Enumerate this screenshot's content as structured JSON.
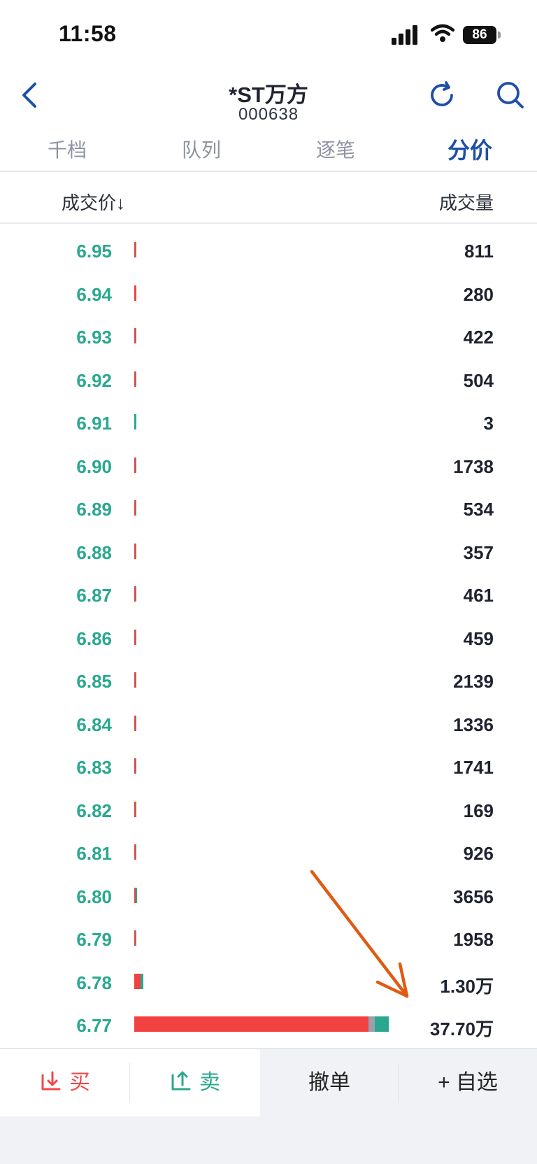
{
  "status": {
    "time": "11:58",
    "battery": "86"
  },
  "header": {
    "title": "*ST万方",
    "code": "000638"
  },
  "tabs": [
    {
      "label": "千档",
      "active": false
    },
    {
      "label": "队列",
      "active": false
    },
    {
      "label": "逐笔",
      "active": false
    },
    {
      "label": "分价",
      "active": true
    }
  ],
  "columns": {
    "price": "成交价↓",
    "volume": "成交量"
  },
  "colors": {
    "red": "#f24141",
    "green": "#2aa88f",
    "gray": "#9aa0ab",
    "accent": "#1e4fa8"
  },
  "rows": [
    {
      "price": "6.95",
      "volume": "811",
      "buy": 0.7,
      "neutral": 0,
      "sell": 0.3
    },
    {
      "price": "6.94",
      "volume": "280",
      "buy": 1.0,
      "neutral": 0,
      "sell": 0.0
    },
    {
      "price": "6.93",
      "volume": "422",
      "buy": 0.6,
      "neutral": 0,
      "sell": 0.4
    },
    {
      "price": "6.92",
      "volume": "504",
      "buy": 0.6,
      "neutral": 0,
      "sell": 0.4
    },
    {
      "price": "6.91",
      "volume": "3",
      "buy": 0.0,
      "neutral": 0,
      "sell": 1.0
    },
    {
      "price": "6.90",
      "volume": "1738",
      "buy": 0.7,
      "neutral": 0,
      "sell": 0.3
    },
    {
      "price": "6.89",
      "volume": "534",
      "buy": 0.6,
      "neutral": 0,
      "sell": 0.4
    },
    {
      "price": "6.88",
      "volume": "357",
      "buy": 0.6,
      "neutral": 0,
      "sell": 0.4
    },
    {
      "price": "6.87",
      "volume": "461",
      "buy": 0.6,
      "neutral": 0,
      "sell": 0.4
    },
    {
      "price": "6.86",
      "volume": "459",
      "buy": 0.6,
      "neutral": 0,
      "sell": 0.4
    },
    {
      "price": "6.85",
      "volume": "2139",
      "buy": 0.6,
      "neutral": 0,
      "sell": 0.4
    },
    {
      "price": "6.84",
      "volume": "1336",
      "buy": 0.6,
      "neutral": 0,
      "sell": 0.4
    },
    {
      "price": "6.83",
      "volume": "1741",
      "buy": 0.6,
      "neutral": 0,
      "sell": 0.4
    },
    {
      "price": "6.82",
      "volume": "169",
      "buy": 0.6,
      "neutral": 0,
      "sell": 0.4
    },
    {
      "price": "6.81",
      "volume": "926",
      "buy": 0.6,
      "neutral": 0,
      "sell": 0.4
    },
    {
      "price": "6.80",
      "volume": "3656",
      "buy": 0.6,
      "neutral": 0,
      "sell": 0.4
    },
    {
      "price": "6.79",
      "volume": "1958",
      "buy": 0.6,
      "neutral": 0,
      "sell": 0.4
    },
    {
      "price": "6.78",
      "volume": "1.30万",
      "buy": 0.7,
      "neutral": 0,
      "sell": 0.3
    },
    {
      "price": "6.77",
      "volume": "37.70万",
      "buy": 0.92,
      "neutral": 0.025,
      "sell": 0.055
    }
  ],
  "toolbar": {
    "buy": "买",
    "sell": "卖",
    "cancel": "撤单",
    "watch": "+ 自选"
  }
}
